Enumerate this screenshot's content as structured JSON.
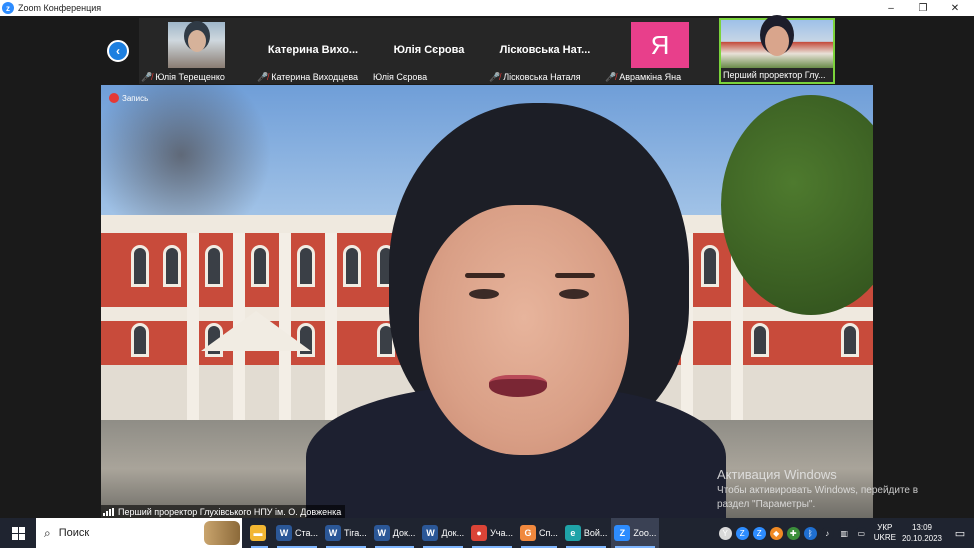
{
  "window": {
    "title": "Zoom Конференция",
    "minimize": "–",
    "restore": "❐",
    "close": "✕"
  },
  "strip": {
    "nav_left_icon": "chevron-left-icon",
    "participants": [
      {
        "name": "Юлія Терещенко",
        "muted": true,
        "display": "photo"
      },
      {
        "name": "Катерина Виходцева",
        "big_name": "Катерина  Вихо...",
        "muted": true,
        "display": "name"
      },
      {
        "name": "Юлія Сєрова",
        "big_name": "Юлія Сєрова",
        "muted": false,
        "display": "name"
      },
      {
        "name": "Лісковська Наталя",
        "big_name": "Лісковська  Нат...",
        "muted": true,
        "display": "name"
      },
      {
        "name": "Аврамкіна Яна",
        "avatar_letter": "Я",
        "avatar_color": "#e83f8b",
        "muted": true,
        "display": "letter"
      },
      {
        "name": "Перший проректор Глу...",
        "muted": false,
        "display": "photo",
        "active": true
      }
    ]
  },
  "main_video": {
    "recording_label": "Запись",
    "speaker_label": "Перший проректор Глухівського НПУ ім. О. Довженка"
  },
  "activation": {
    "line1": "Активация Windows",
    "line2": "Чтобы активировать Windows, перейдите в",
    "line3": "раздел \"Параметры\"."
  },
  "taskbar": {
    "search_placeholder": "Поиск",
    "apps": [
      {
        "label": "",
        "icon": "file-explorer-icon",
        "color": "#f2b632",
        "glyph": "▬"
      },
      {
        "label": "Ста...",
        "icon": "word-icon",
        "color": "#2b5797",
        "glyph": "W"
      },
      {
        "label": "Tiга...",
        "icon": "word-icon",
        "color": "#2b5797",
        "glyph": "W"
      },
      {
        "label": "Док...",
        "icon": "word-icon",
        "color": "#2b5797",
        "glyph": "W"
      },
      {
        "label": "Док...",
        "icon": "word-icon",
        "color": "#2b5797",
        "glyph": "W"
      },
      {
        "label": "Уча...",
        "icon": "chrome-icon",
        "color": "#db4437",
        "glyph": "●"
      },
      {
        "label": "Сп...",
        "icon": "app-orange-icon",
        "color": "#f0883e",
        "glyph": "G"
      },
      {
        "label": "Вой...",
        "icon": "edge-icon",
        "color": "#1fa3a8",
        "glyph": "e"
      },
      {
        "label": "Zoo...",
        "icon": "zoom-icon",
        "color": "#2d8cff",
        "glyph": "Z",
        "active": true
      }
    ],
    "tray_icons": [
      {
        "icon": "yandex-icon",
        "color": "#d9d9d9",
        "glyph": "Y"
      },
      {
        "icon": "zoom-tray-icon",
        "color": "#2d8cff",
        "glyph": "Z"
      },
      {
        "icon": "zoom-tray-icon-2",
        "color": "#2d8cff",
        "glyph": "Z"
      },
      {
        "icon": "orange-app-icon",
        "color": "#f08a24",
        "glyph": "◆"
      },
      {
        "icon": "shield-icon",
        "color": "#3b8f3b",
        "glyph": "✚"
      },
      {
        "icon": "bluetooth-icon",
        "color": "#1f6fd1",
        "glyph": "ᛒ"
      },
      {
        "icon": "speaker-icon",
        "color": "#1f2430",
        "glyph": "♪"
      },
      {
        "icon": "network-icon",
        "color": "#1f2430",
        "glyph": "▥"
      },
      {
        "icon": "battery-icon",
        "color": "#1f2430",
        "glyph": "▭"
      }
    ],
    "language_line1": "УКР",
    "language_line2": "UKRE",
    "time": "13:09",
    "date": "20.10.2023",
    "notification_icon": "notification-icon"
  }
}
